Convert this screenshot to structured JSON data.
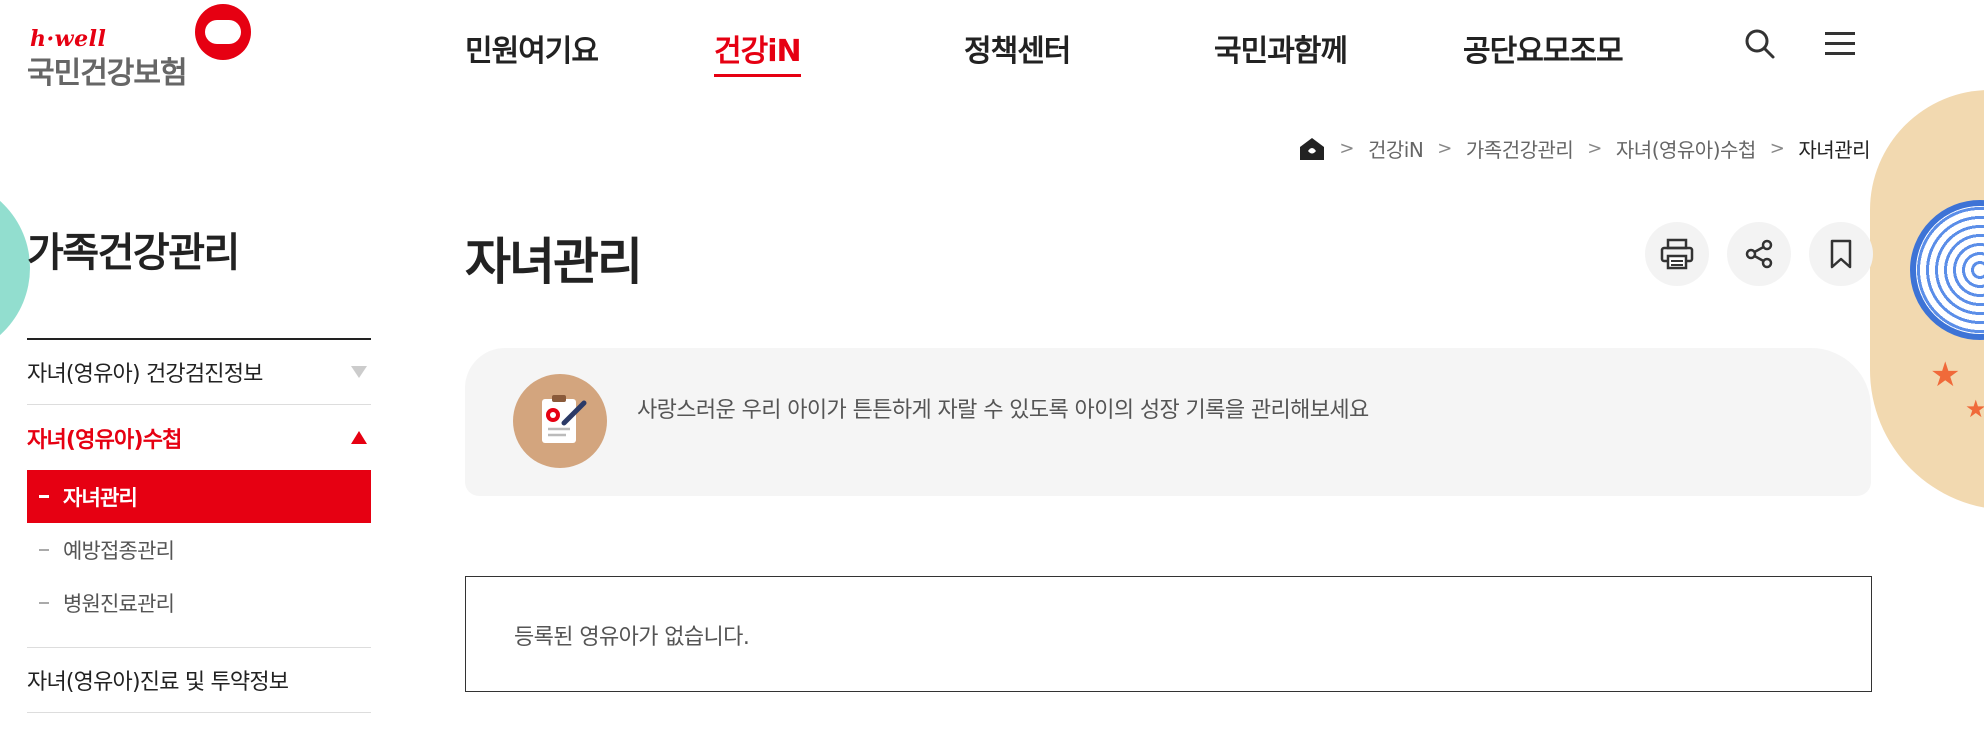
{
  "logo": {
    "tag": "h·well",
    "name": "국민건강보험"
  },
  "nav": [
    {
      "label": "민원여기요"
    },
    {
      "label": "건강iN",
      "active": true
    },
    {
      "label": "정책센터"
    },
    {
      "label": "국민과함께"
    },
    {
      "label": "공단요모조모"
    }
  ],
  "icons": {
    "search": "search-icon",
    "menu": "hamburger-menu-icon",
    "home": "home-icon",
    "print": "printer-icon",
    "share": "share-icon",
    "bookmark": "bookmark-icon"
  },
  "colors": {
    "accent": "#e60012",
    "info_bg": "#f5f5f5",
    "info_icon_bg": "#d3a57e"
  },
  "breadcrumb": [
    "건강iN",
    "가족건강관리",
    "자녀(영유아)수첩",
    "자녀관리"
  ],
  "sidebar": {
    "title": "가족건강관리",
    "items": [
      {
        "label": "자녀(영유아) 건강검진정보",
        "expanded": false
      },
      {
        "label": "자녀(영유아)수첩",
        "expanded": true,
        "subitems": [
          {
            "label": "자녀관리",
            "active": true
          },
          {
            "label": "예방접종관리"
          },
          {
            "label": "병원진료관리"
          }
        ]
      },
      {
        "label": "자녀(영유아)진료 및 투약정보",
        "expanded": false
      }
    ]
  },
  "main": {
    "title": "자녀관리",
    "info_text": "사랑스러운 우리 아이가 튼튼하게 자랄 수 있도록 아이의 성장 기록을 관리해보세요",
    "empty_text": "등록된 영유아가 없습니다."
  }
}
